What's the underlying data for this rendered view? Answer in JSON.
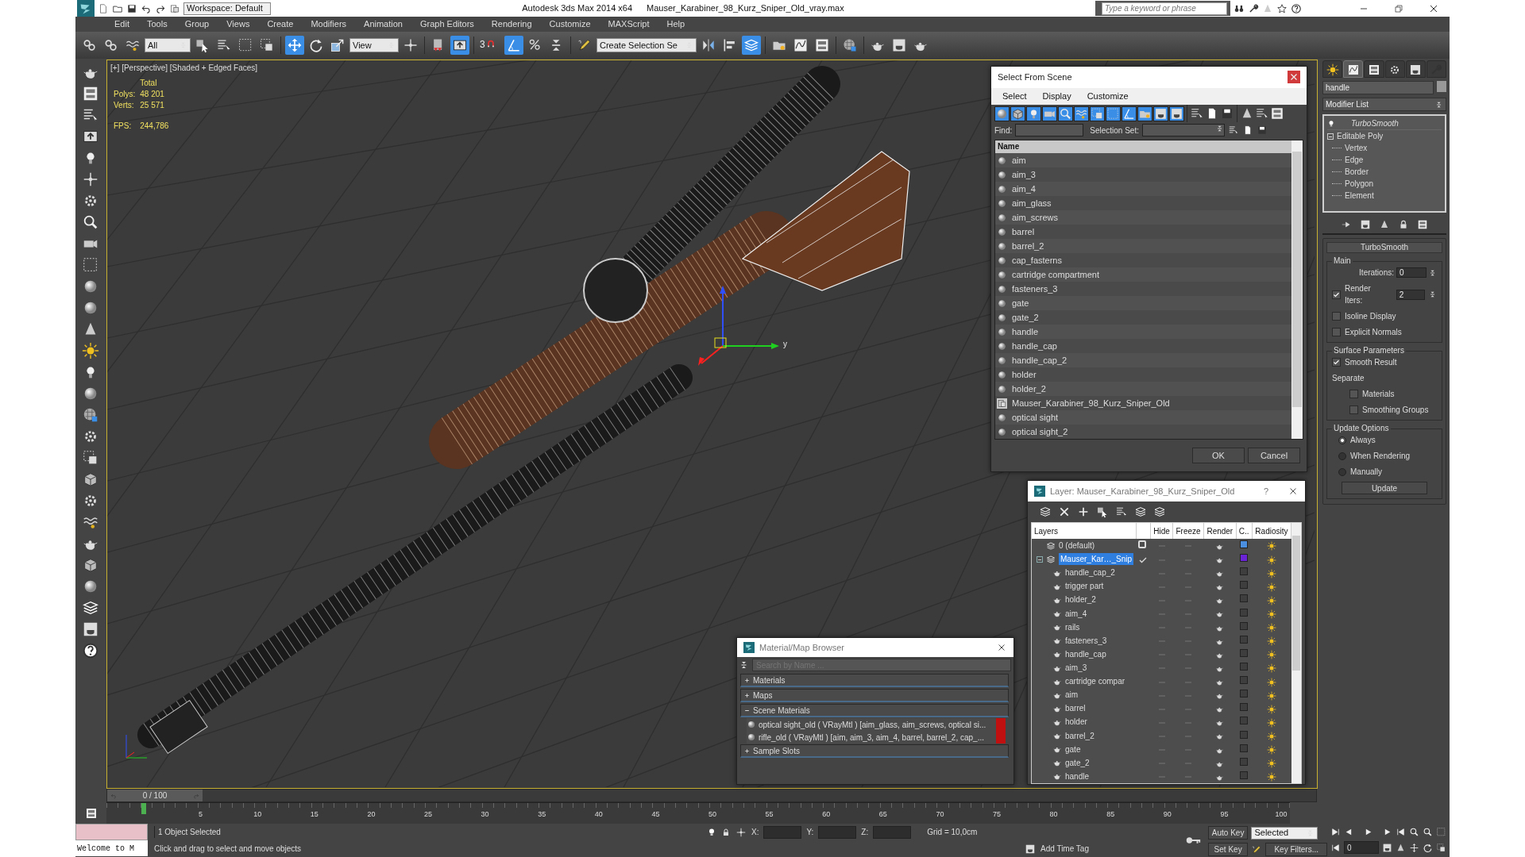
{
  "title_bar": {
    "workspace": "Workspace: Default",
    "app": "Autodesk 3ds Max  2014 x64",
    "file": "Mauser_Karabiner_98_Kurz_Sniper_Old_vray.max",
    "search_placeholder": "Type a keyword or phrase"
  },
  "menu": [
    "Edit",
    "Tools",
    "Group",
    "Views",
    "Create",
    "Modifiers",
    "Animation",
    "Graph Editors",
    "Rendering",
    "Customize",
    "MAXScript",
    "Help"
  ],
  "toolbar": {
    "selection_filter": "All",
    "coordinate_system": "View",
    "snap_dimension": "3",
    "named_selection": "Create Selection Se",
    "tools": [
      {
        "on": false
      },
      {
        "on": false
      },
      {
        "on": false
      },
      {
        "on": false
      },
      {
        "on": false
      },
      {
        "on": false
      },
      {
        "on": false
      },
      {
        "on": true
      },
      {
        "on": false
      },
      {
        "on": false
      },
      {
        "on": false
      },
      {
        "on": false
      },
      {
        "on": true
      },
      {
        "on": false
      },
      {
        "on": true
      },
      {
        "on": false
      },
      {
        "on": false
      },
      {
        "on": false
      },
      {
        "on": false
      },
      {
        "on": false
      },
      {
        "on": true
      },
      {
        "on": false
      },
      {
        "on": false
      },
      {
        "on": false
      },
      {
        "on": false
      },
      {
        "on": false
      },
      {
        "on": false
      },
      {
        "on": false
      }
    ]
  },
  "viewport": {
    "label": "[+] [Perspective] [Shaded + Edged Faces]",
    "stats_heading": "Total",
    "stats": [
      {
        "label": "Polys:",
        "value": "48 201"
      },
      {
        "label": "Verts:",
        "value": "25 571"
      }
    ],
    "fps_label": "FPS:",
    "fps": "244,786",
    "gizmo_label": "y"
  },
  "select_from_scene": {
    "title": "Select From Scene",
    "menu": [
      "Select",
      "Display",
      "Customize"
    ],
    "filters": [
      {
        "on": true
      },
      {
        "on": true
      },
      {
        "on": true
      },
      {
        "on": true
      },
      {
        "on": true
      },
      {
        "on": true
      },
      {
        "on": true
      },
      {
        "on": true
      },
      {
        "on": true
      },
      {
        "on": true
      },
      {
        "on": true
      },
      {
        "on": true
      }
    ],
    "find_label": "Find:",
    "selection_set_label": "Selection Set:",
    "column": "Name",
    "items": [
      {
        "name": "aim",
        "kind": "object"
      },
      {
        "name": "aim_3",
        "kind": "object"
      },
      {
        "name": "aim_4",
        "kind": "object"
      },
      {
        "name": "aim_glass",
        "kind": "object"
      },
      {
        "name": "aim_screws",
        "kind": "object"
      },
      {
        "name": "barrel",
        "kind": "object"
      },
      {
        "name": "barrel_2",
        "kind": "object"
      },
      {
        "name": "cap_fasterns",
        "kind": "object"
      },
      {
        "name": "cartridge compartment",
        "kind": "object"
      },
      {
        "name": "fasteners_3",
        "kind": "object"
      },
      {
        "name": "gate",
        "kind": "object"
      },
      {
        "name": "gate_2",
        "kind": "object"
      },
      {
        "name": "handle",
        "kind": "object"
      },
      {
        "name": "handle_cap",
        "kind": "object"
      },
      {
        "name": "handle_cap_2",
        "kind": "object"
      },
      {
        "name": "holder",
        "kind": "object"
      },
      {
        "name": "holder_2",
        "kind": "object"
      },
      {
        "name": "Mauser_Karabiner_98_Kurz_Sniper_Old",
        "kind": "group"
      },
      {
        "name": "optical sight",
        "kind": "object"
      },
      {
        "name": "optical sight_2",
        "kind": "object"
      }
    ],
    "buttons": [
      "OK",
      "Cancel"
    ]
  },
  "command_panel": {
    "tabs": [
      {
        "selected": false
      },
      {
        "selected": true
      },
      {
        "selected": false
      },
      {
        "selected": false
      },
      {
        "selected": false
      },
      {
        "selected": false
      }
    ],
    "object_name": "handle",
    "modifier_list": "Modifier List",
    "stack": [
      {
        "label": "TurboSmooth",
        "kind": "modifier"
      },
      {
        "label": "Editable Poly",
        "kind": "base",
        "expanded": true,
        "children": [
          {
            "label": "Vertex"
          },
          {
            "label": "Edge"
          },
          {
            "label": "Border"
          },
          {
            "label": "Polygon"
          },
          {
            "label": "Element"
          }
        ]
      }
    ],
    "rollout": {
      "title": "TurboSmooth",
      "main": {
        "title": "Main",
        "iterations_label": "Iterations:",
        "iterations": "0",
        "render_iters_label": "Render Iters:",
        "render_iters_checked": true,
        "render_iters": "2",
        "options": [
          {
            "label": "Isoline Display",
            "checked": false
          },
          {
            "label": "Explicit Normals",
            "checked": false
          }
        ]
      },
      "surface": {
        "title": "Surface Parameters",
        "smooth_result": {
          "label": "Smooth Result",
          "checked": true
        },
        "separate_label": "Separate",
        "separate": [
          {
            "label": "Materials",
            "checked": false
          },
          {
            "label": "Smoothing Groups",
            "checked": false
          }
        ]
      },
      "update": {
        "title": "Update Options",
        "options": [
          {
            "label": "Always",
            "selected": true
          },
          {
            "label": "When Rendering",
            "selected": false
          },
          {
            "label": "Manually",
            "selected": false
          }
        ],
        "button": "Update"
      }
    }
  },
  "layer_dialog": {
    "title": "Layer: Mauser_Karabiner_98_Kurz_Sniper_Old",
    "help": "?",
    "columns": [
      "Layers",
      "Hide",
      "Freeze",
      "Render",
      "C..",
      "Radiosity"
    ],
    "layers": [
      {
        "name": "0 (default)",
        "selected": false,
        "current": false,
        "color": "#4a8fe0"
      },
      {
        "name": "Mauser_Kar…_Snip",
        "selected": true,
        "current": true,
        "expanded": true,
        "color": "#6a24d6",
        "children": [
          {
            "name": "handle_cap_2"
          },
          {
            "name": "trigger part"
          },
          {
            "name": "holder_2"
          },
          {
            "name": "aim_4"
          },
          {
            "name": "rails"
          },
          {
            "name": "fasteners_3"
          },
          {
            "name": "handle_cap"
          },
          {
            "name": "aim_3"
          },
          {
            "name": "cartridge compar"
          },
          {
            "name": "aim"
          },
          {
            "name": "barrel"
          },
          {
            "name": "holder"
          },
          {
            "name": "barrel_2"
          },
          {
            "name": "gate"
          },
          {
            "name": "gate_2"
          },
          {
            "name": "handle"
          }
        ]
      }
    ]
  },
  "material_browser": {
    "title": "Material/Map Browser",
    "search_placeholder": "Search by Name ...",
    "sections": [
      {
        "label": "Materials",
        "expanded": false
      },
      {
        "label": "Maps",
        "expanded": false
      },
      {
        "label": "Scene Materials",
        "expanded": true,
        "items": [
          "optical sight_old ( VRayMtl ) [aim_glass, aim_screws, optical si...",
          "rifle_old  ( VRayMtl )  [aim, aim_3, aim_4, barrel, barrel_2, cap_..."
        ]
      },
      {
        "label": "Sample Slots",
        "expanded": false
      }
    ]
  },
  "timeline": {
    "position": "0 / 100",
    "level": 0,
    "ticks": [
      "5",
      "10",
      "15",
      "20",
      "25",
      "30",
      "35",
      "40",
      "45",
      "50",
      "55",
      "60",
      "65",
      "70",
      "75",
      "80",
      "85",
      "90",
      "95",
      "100"
    ]
  },
  "status_bar": {
    "listener": "Welcome to M",
    "selection": "1 Object Selected",
    "prompt": "Click and drag to select and move objects",
    "x_label": "X:",
    "y_label": "Y:",
    "z_label": "Z:",
    "grid": "Grid = 10,0cm",
    "add_time_tag": "Add Time Tag",
    "auto_key": "Auto Key",
    "key_mode": "Selected",
    "set_key": "Set Key",
    "key_filters": "Key Filters...",
    "frame": "0"
  }
}
